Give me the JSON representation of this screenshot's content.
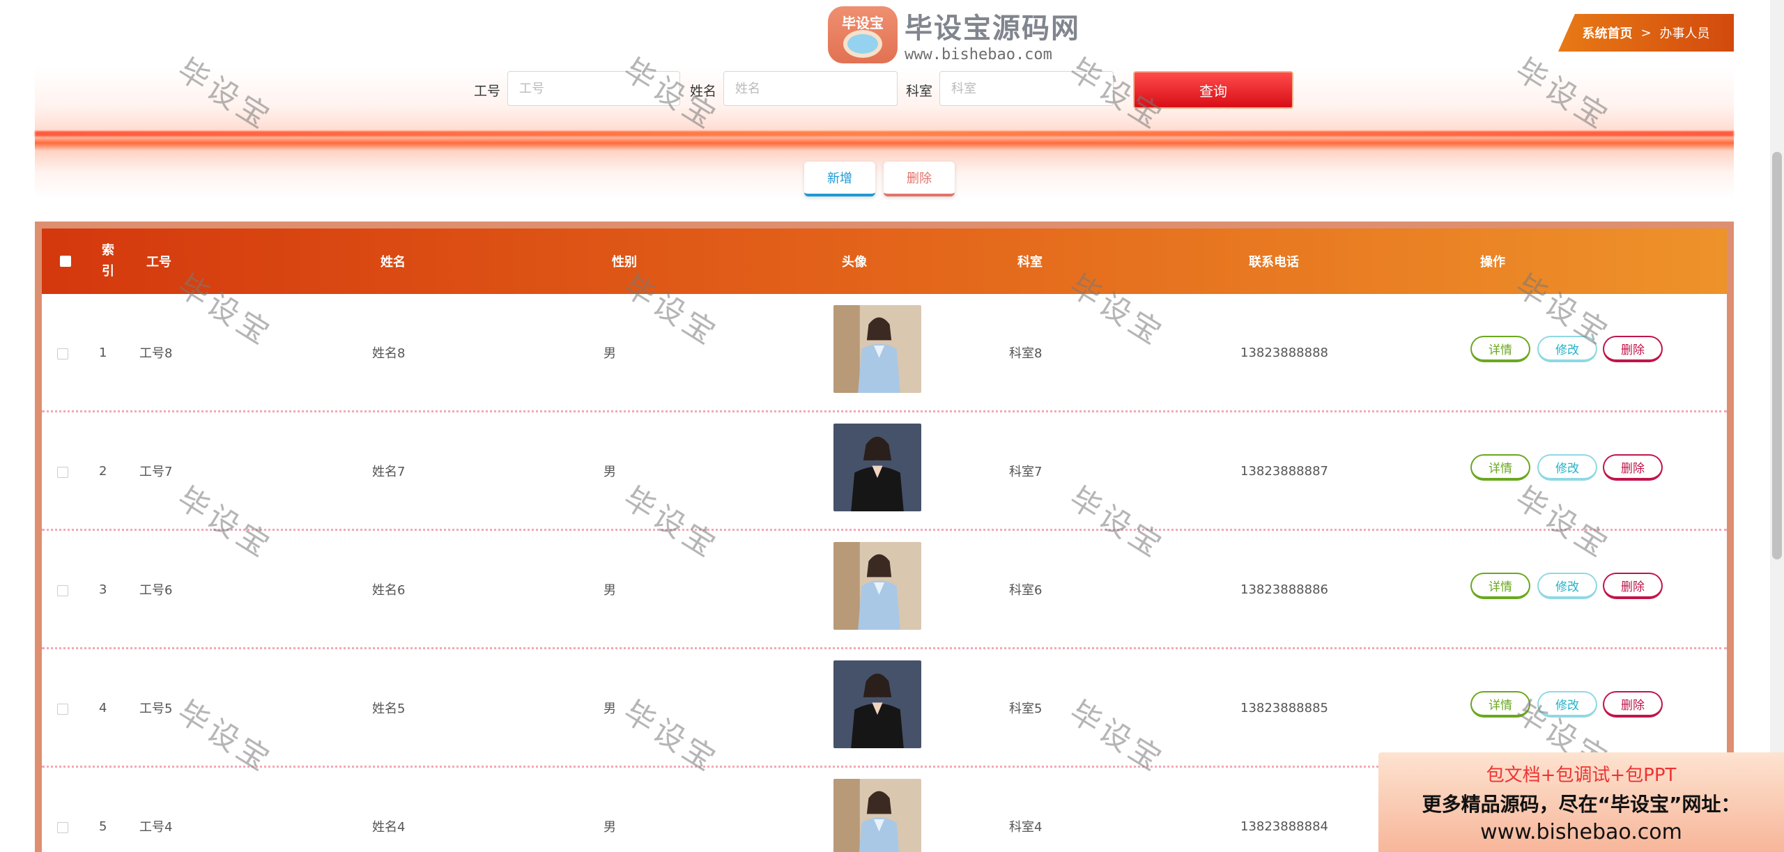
{
  "breadcrumb": {
    "home": "系统首页",
    "separator": ">",
    "current": "办事人员"
  },
  "logo": {
    "badge": "毕设宝",
    "name": "毕设宝源码网",
    "url": "www.bishebao.com"
  },
  "search": {
    "fields": [
      {
        "label": "工号",
        "placeholder": "工号"
      },
      {
        "label": "姓名",
        "placeholder": "姓名"
      },
      {
        "label": "科室",
        "placeholder": "科室"
      }
    ],
    "query_label": "查询"
  },
  "actions": {
    "add_label": "新增",
    "delete_label": "删除"
  },
  "table": {
    "headers": {
      "index": "索引",
      "staff_id": "工号",
      "name": "姓名",
      "gender": "性别",
      "avatar": "头像",
      "department": "科室",
      "phone": "联系电话",
      "operation": "操作"
    },
    "buttons": {
      "detail": "详情",
      "edit": "修改",
      "delete": "删除"
    },
    "rows": [
      {
        "index": "1",
        "staff_id": "工号8",
        "name": "姓名8",
        "gender": "男",
        "department": "科室8",
        "phone": "13823888888",
        "avatar_style": "light-blue-blouse"
      },
      {
        "index": "2",
        "staff_id": "工号7",
        "name": "姓名7",
        "gender": "男",
        "department": "科室7",
        "phone": "13823888887",
        "avatar_style": "black-shirt"
      },
      {
        "index": "3",
        "staff_id": "工号6",
        "name": "姓名6",
        "gender": "男",
        "department": "科室6",
        "phone": "13823888886",
        "avatar_style": "light-blue-blouse"
      },
      {
        "index": "4",
        "staff_id": "工号5",
        "name": "姓名5",
        "gender": "男",
        "department": "科室5",
        "phone": "13823888885",
        "avatar_style": "black-shirt"
      },
      {
        "index": "5",
        "staff_id": "工号4",
        "name": "姓名4",
        "gender": "男",
        "department": "科室4",
        "phone": "13823888884",
        "avatar_style": "light-blue-blouse"
      }
    ]
  },
  "watermark": "毕设宝",
  "ad": {
    "line1": "包文档+包调试+包PPT",
    "line2": "更多精品源码，尽在“毕设宝”网址：",
    "line3": "www.bishebao.com"
  },
  "colors": {
    "header_start": "#d4380d",
    "header_end": "#ee922a",
    "query_button": "#d80e16",
    "detail": "#6aa81e",
    "edit": "#21b3c9",
    "delete": "#c0154a"
  }
}
